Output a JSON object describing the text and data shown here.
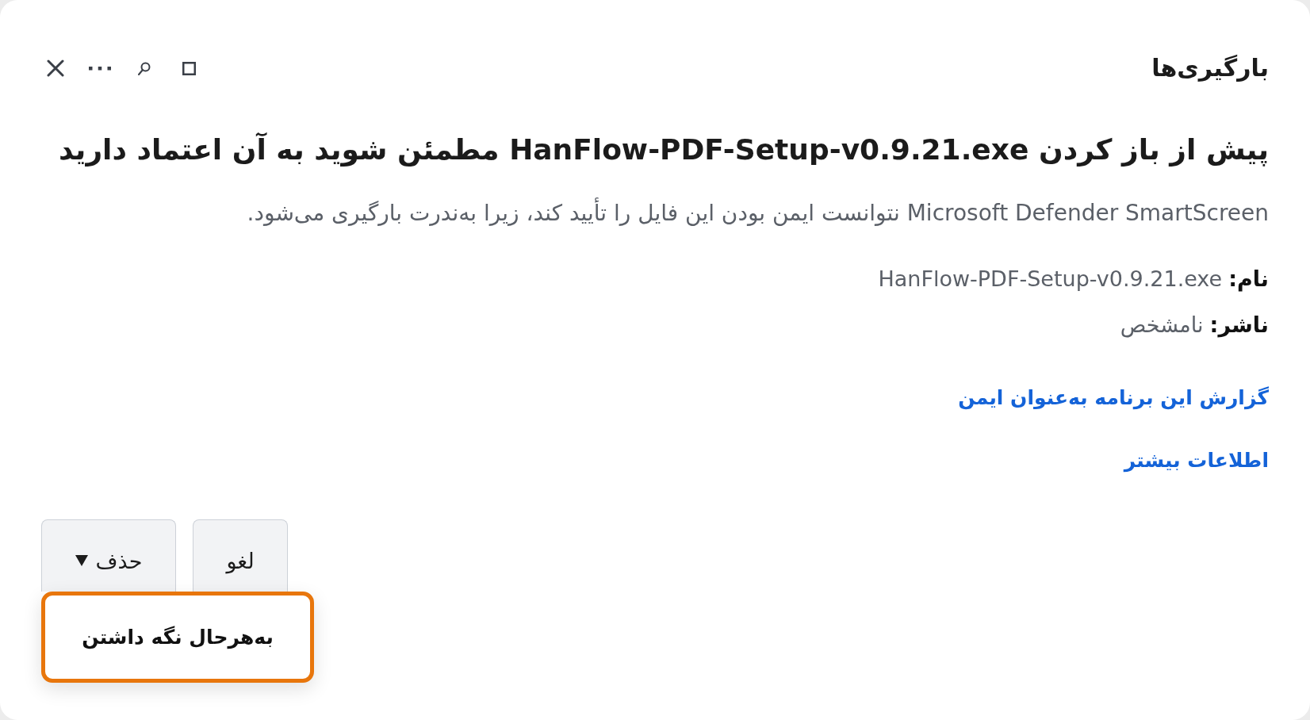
{
  "header": {
    "title": "بارگیری‌ها"
  },
  "warning": {
    "heading": "پیش از باز کردن HanFlow-PDF-Setup-v0.9.21.exe مطمئن شوید به آن اعتماد دارید",
    "message": "Microsoft Defender SmartScreen نتوانست ایمن بودن این فایل را تأیید کند، زیرا به‌ندرت بارگیری می‌شود."
  },
  "details": [
    {
      "label": "نام:",
      "value": "HanFlow-PDF-Setup-v0.9.21.exe"
    },
    {
      "label": "ناشر:",
      "value": "نامشخص"
    }
  ],
  "links": [
    "گزارش این برنامه به‌عنوان ایمن",
    "اطلاعات بیشتر"
  ],
  "buttons": [
    {
      "label": "لغو",
      "kind": "plain"
    },
    {
      "label": "حذف",
      "kind": "menu",
      "menu": [
        {
          "label": "به‌هرحال نگه داشتن",
          "focused": true
        }
      ]
    }
  ]
}
